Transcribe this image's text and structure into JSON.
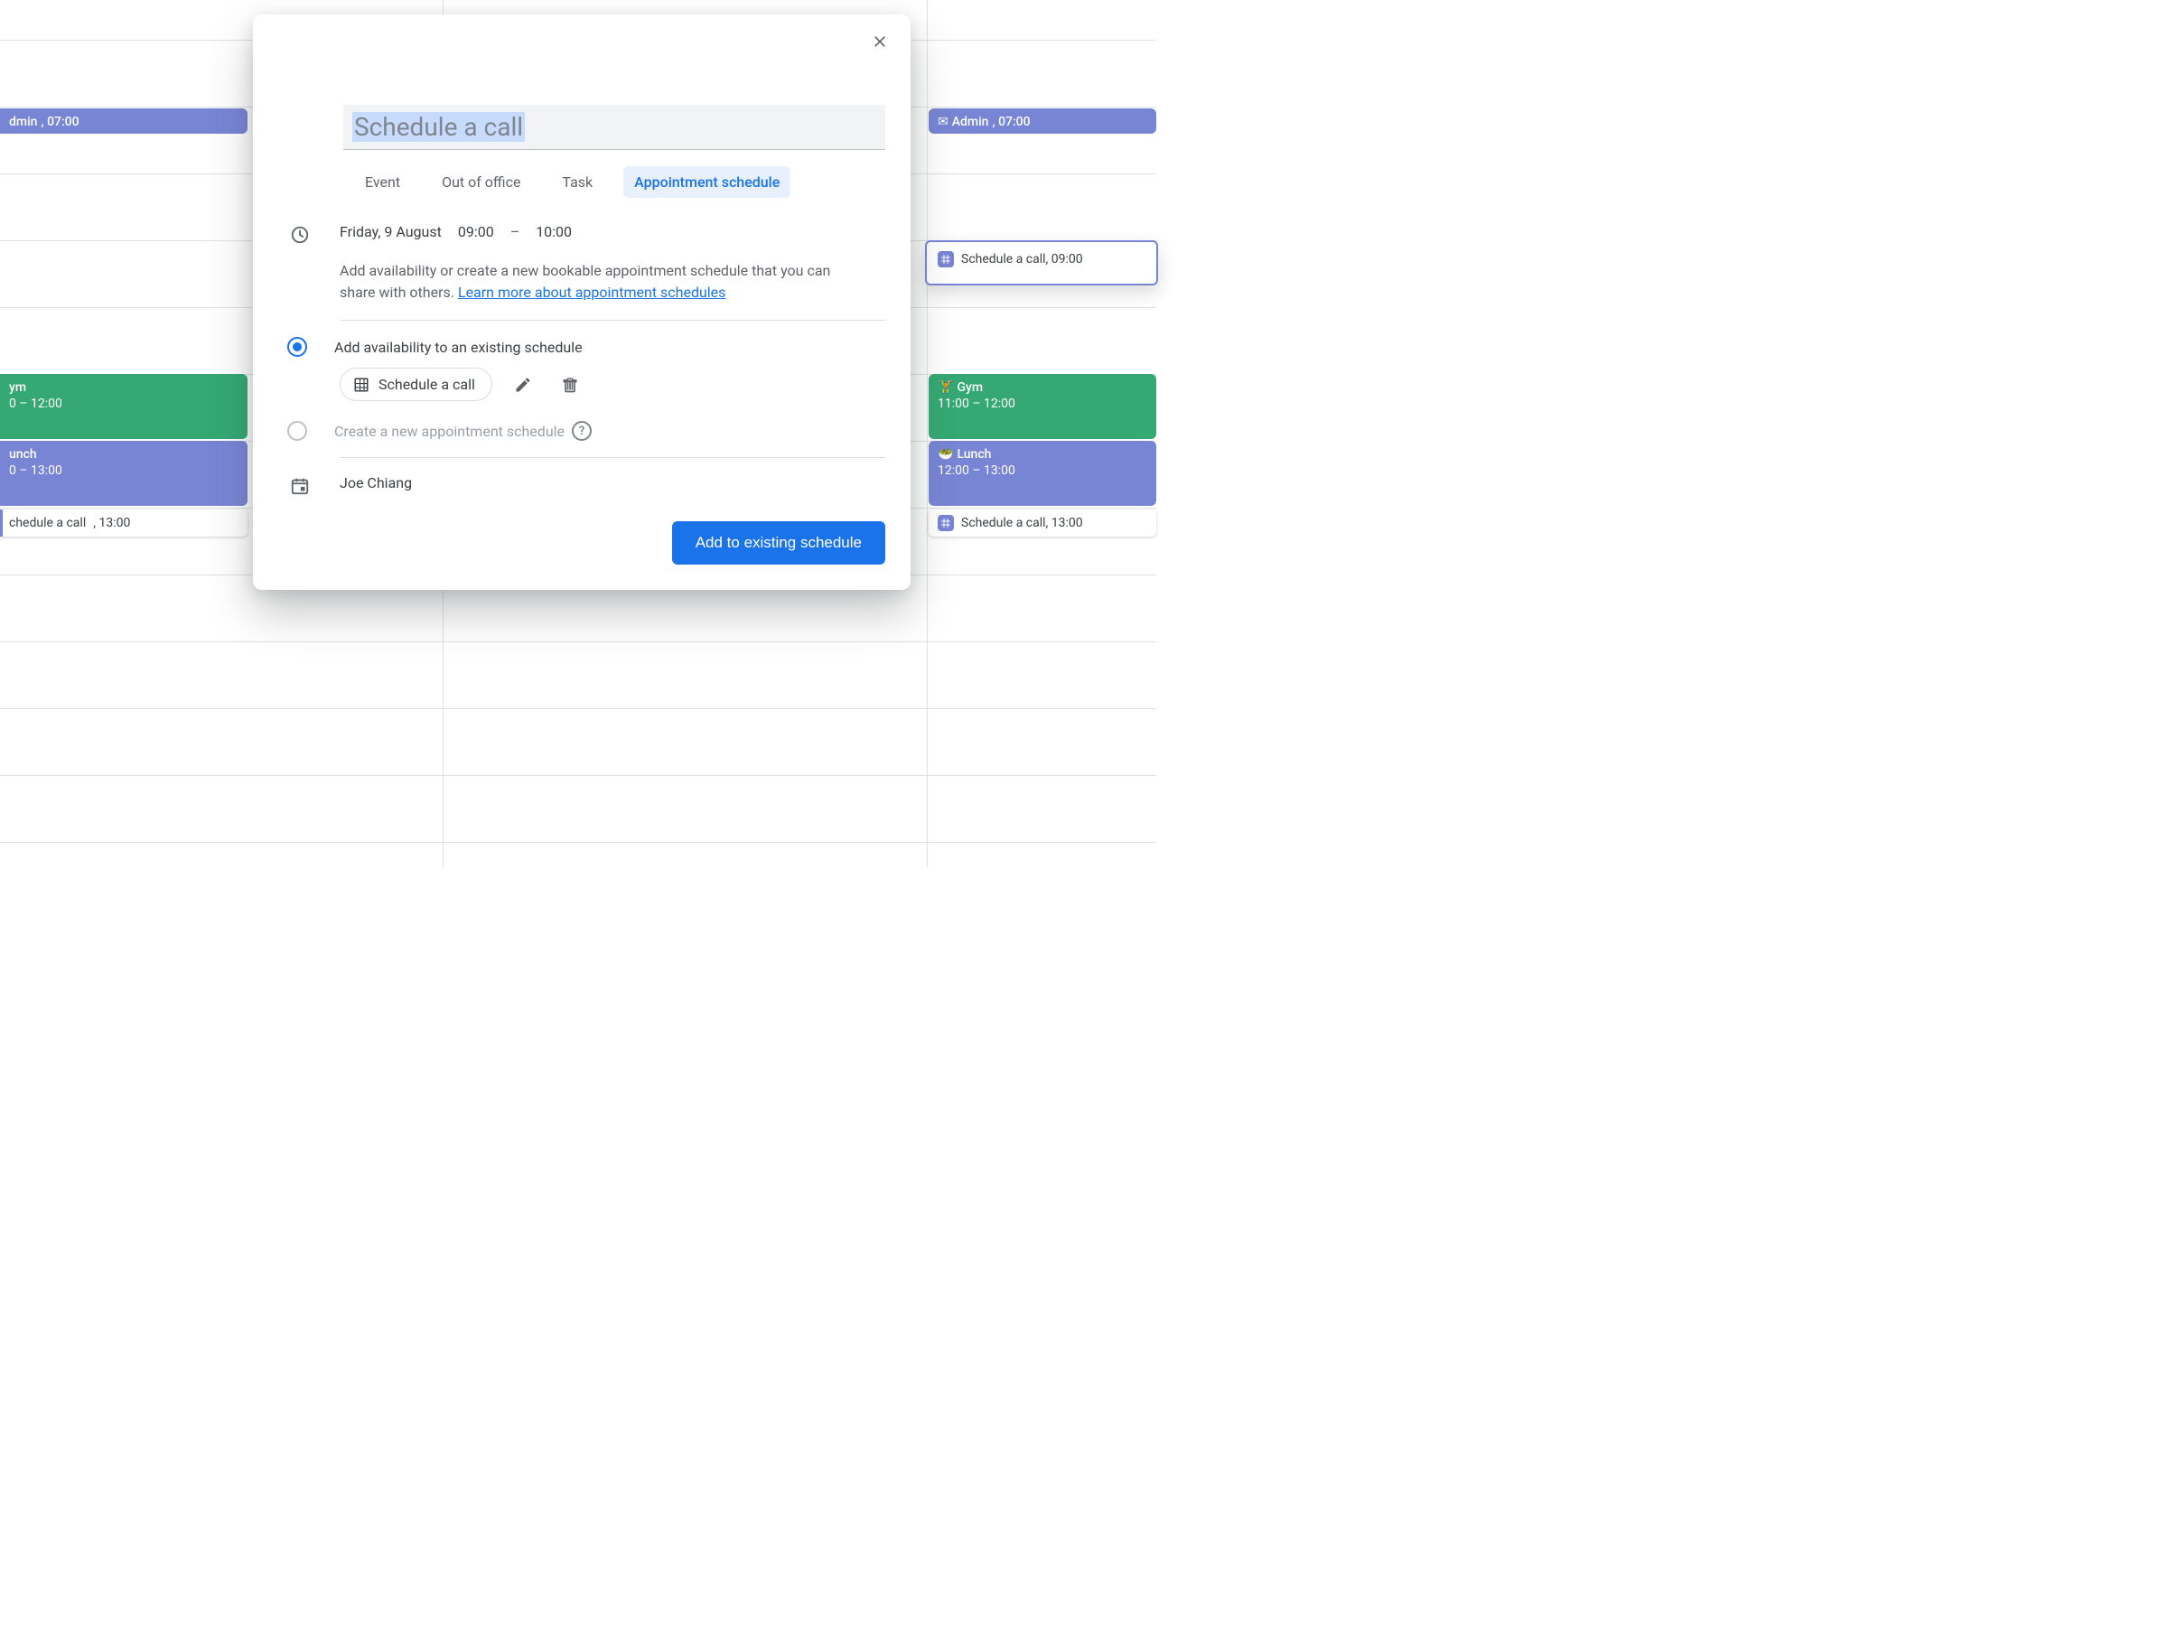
{
  "dialog": {
    "title_value": "Schedule a call",
    "tabs": {
      "event": "Event",
      "out_of_office": "Out of office",
      "task": "Task",
      "appointment_schedule": "Appointment schedule"
    },
    "date": "Friday, 9 August",
    "time_start": "09:00",
    "time_sep": "–",
    "time_end": "10:00",
    "description": "Add availability or create a new bookable appointment schedule that you can share with others. ",
    "learn_more": "Learn more about appointment schedules",
    "option_existing": "Add availability to an existing schedule",
    "existing_chip": "Schedule a call",
    "option_new": "Create a new appointment schedule",
    "calendar_owner": "Joe Chiang",
    "submit": "Add to existing schedule"
  },
  "bg_events": {
    "left": {
      "admin": {
        "title": "dmin",
        "time": ", 07:00"
      },
      "gym": {
        "title": "ym",
        "time": "0 – 12:00"
      },
      "lunch": {
        "title": "unch",
        "time": "0 – 13:00"
      },
      "sched": {
        "title": "chedule a call",
        "time": ", 13:00"
      }
    },
    "right": {
      "admin": {
        "title": "Admin",
        "time": ", 07:00"
      },
      "sched_9": {
        "title": "Schedule a call",
        "time": ", 09:00"
      },
      "gym": {
        "title": "Gym",
        "time": "11:00 – 12:00"
      },
      "lunch": {
        "title": "Lunch",
        "time": "12:00 – 13:00"
      },
      "sched_13": {
        "title": "Schedule a call",
        "time": ", 13:00"
      }
    }
  },
  "emoji": {
    "gym": "🏋️",
    "lunch": "🥗"
  }
}
